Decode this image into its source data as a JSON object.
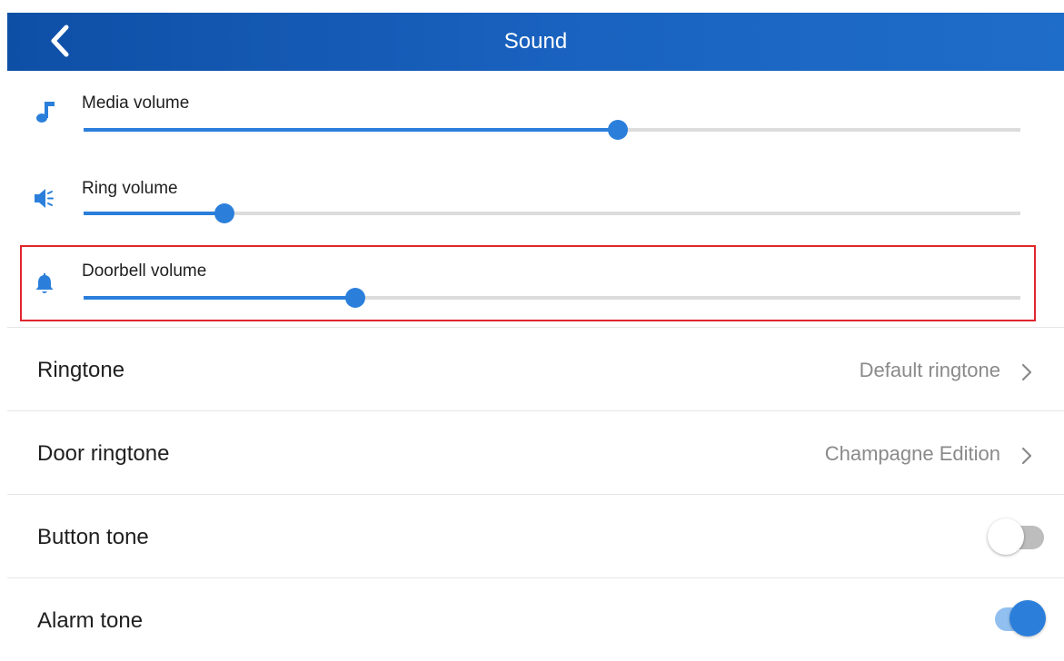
{
  "header": {
    "title": "Sound",
    "back_icon": "chevron-left-icon"
  },
  "volumes": [
    {
      "label": "Media volume",
      "icon": "music-note-icon",
      "level_percent": 57
    },
    {
      "label": "Ring volume",
      "icon": "speaker-icon",
      "level_percent": 15
    },
    {
      "label": "Doorbell volume",
      "icon": "bell-icon",
      "level_percent": 29,
      "highlighted": true
    }
  ],
  "settings": [
    {
      "label": "Ringtone",
      "value": "Default ringtone"
    },
    {
      "label": "Door ringtone",
      "value": "Champagne Edition"
    },
    {
      "label": "Button tone",
      "on": false
    },
    {
      "label": "Alarm tone",
      "on": true
    }
  ],
  "colors": {
    "header_gradient_start": "#0e4fa6",
    "header_gradient_end": "#1e6dc8",
    "accent": "#2b7fdb",
    "highlight_border": "#e0262d",
    "track": "#dcdcdc"
  }
}
